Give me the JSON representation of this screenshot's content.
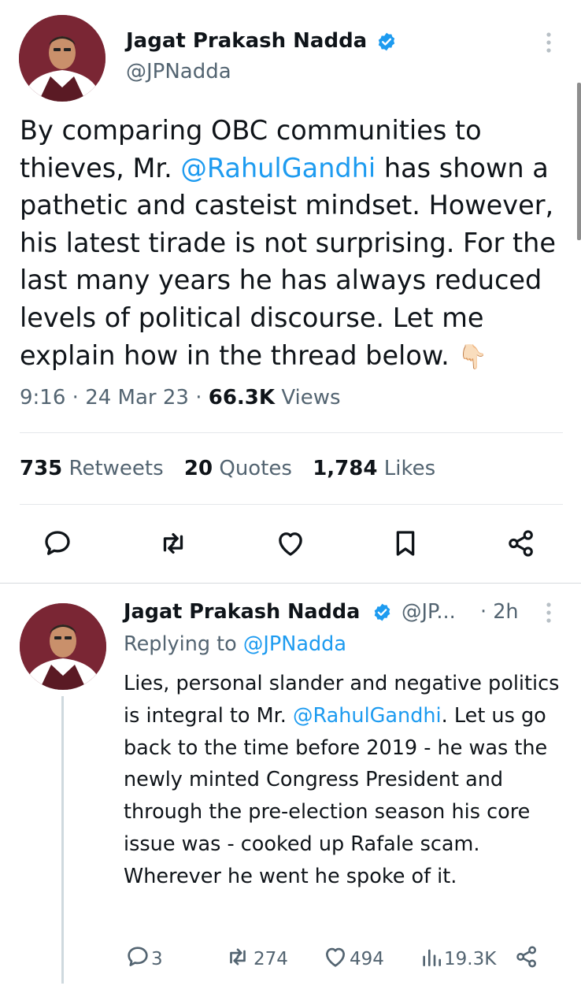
{
  "colors": {
    "accent": "#1d9bf0",
    "text": "#0f1419",
    "muted": "#536471",
    "divider": "#e4e7ea"
  },
  "main_tweet": {
    "author_name": "Jagat Prakash Nadda",
    "handle": "@JPNadda",
    "text_before_mention": "By comparing OBC communities to thieves, Mr. ",
    "mention": "@RahulGandhi",
    "text_after_mention": " has shown a pathetic and casteist mindset. However, his latest tirade is not surprising. For the last many years he has always reduced levels of political discourse. Let me explain how in the thread below.",
    "emoji": "👇🏻",
    "time": "9:16",
    "date": "24 Mar 23",
    "views_count": "66.3K",
    "views_label": "Views",
    "stats": {
      "retweets_count": "735",
      "retweets_label": "Retweets",
      "quotes_count": "20",
      "quotes_label": "Quotes",
      "likes_count": "1,784",
      "likes_label": "Likes"
    }
  },
  "reply_tweet": {
    "author_name": "Jagat Prakash Nadda",
    "handle": "@JP...",
    "time_ago": "· 2h",
    "replying_to_label": "Replying to",
    "replying_to_handle": "@JPNadda",
    "text_before_mention": "Lies, personal slander and negative politics is integral to Mr. ",
    "mention": "@RahulGandhi",
    "text_after_mention": ". Let us go back to the time before 2019 - he was the newly minted Congress President and through the pre-election season his core issue was - cooked up Rafale scam. Wherever he went he spoke of it.",
    "replies_count": "3",
    "retweets_count": "274",
    "likes_count": "494",
    "views_count": "19.3K"
  }
}
